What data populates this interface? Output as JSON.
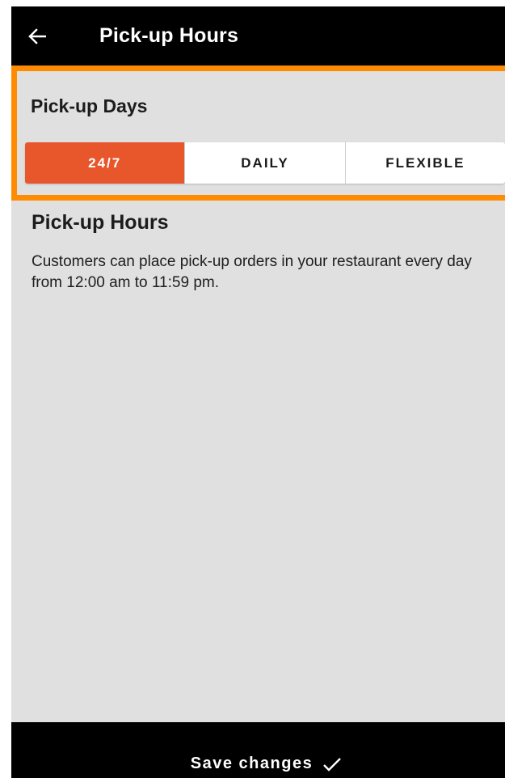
{
  "header": {
    "title": "Pick-up Hours",
    "back_icon": "arrow-left-icon"
  },
  "days": {
    "title": "Pick-up Days",
    "options": [
      "24/7",
      "DAILY",
      "FLEXIBLE"
    ],
    "selected": "24/7",
    "accent_color": "#e8562c",
    "highlight_color": "#ff8c00"
  },
  "hours": {
    "title": "Pick-up Hours",
    "description": "Customers can place pick-up orders in your restaurant every day from 12:00 am to 11:59 pm."
  },
  "footer": {
    "save_label": "Save changes",
    "save_icon": "check-icon"
  }
}
